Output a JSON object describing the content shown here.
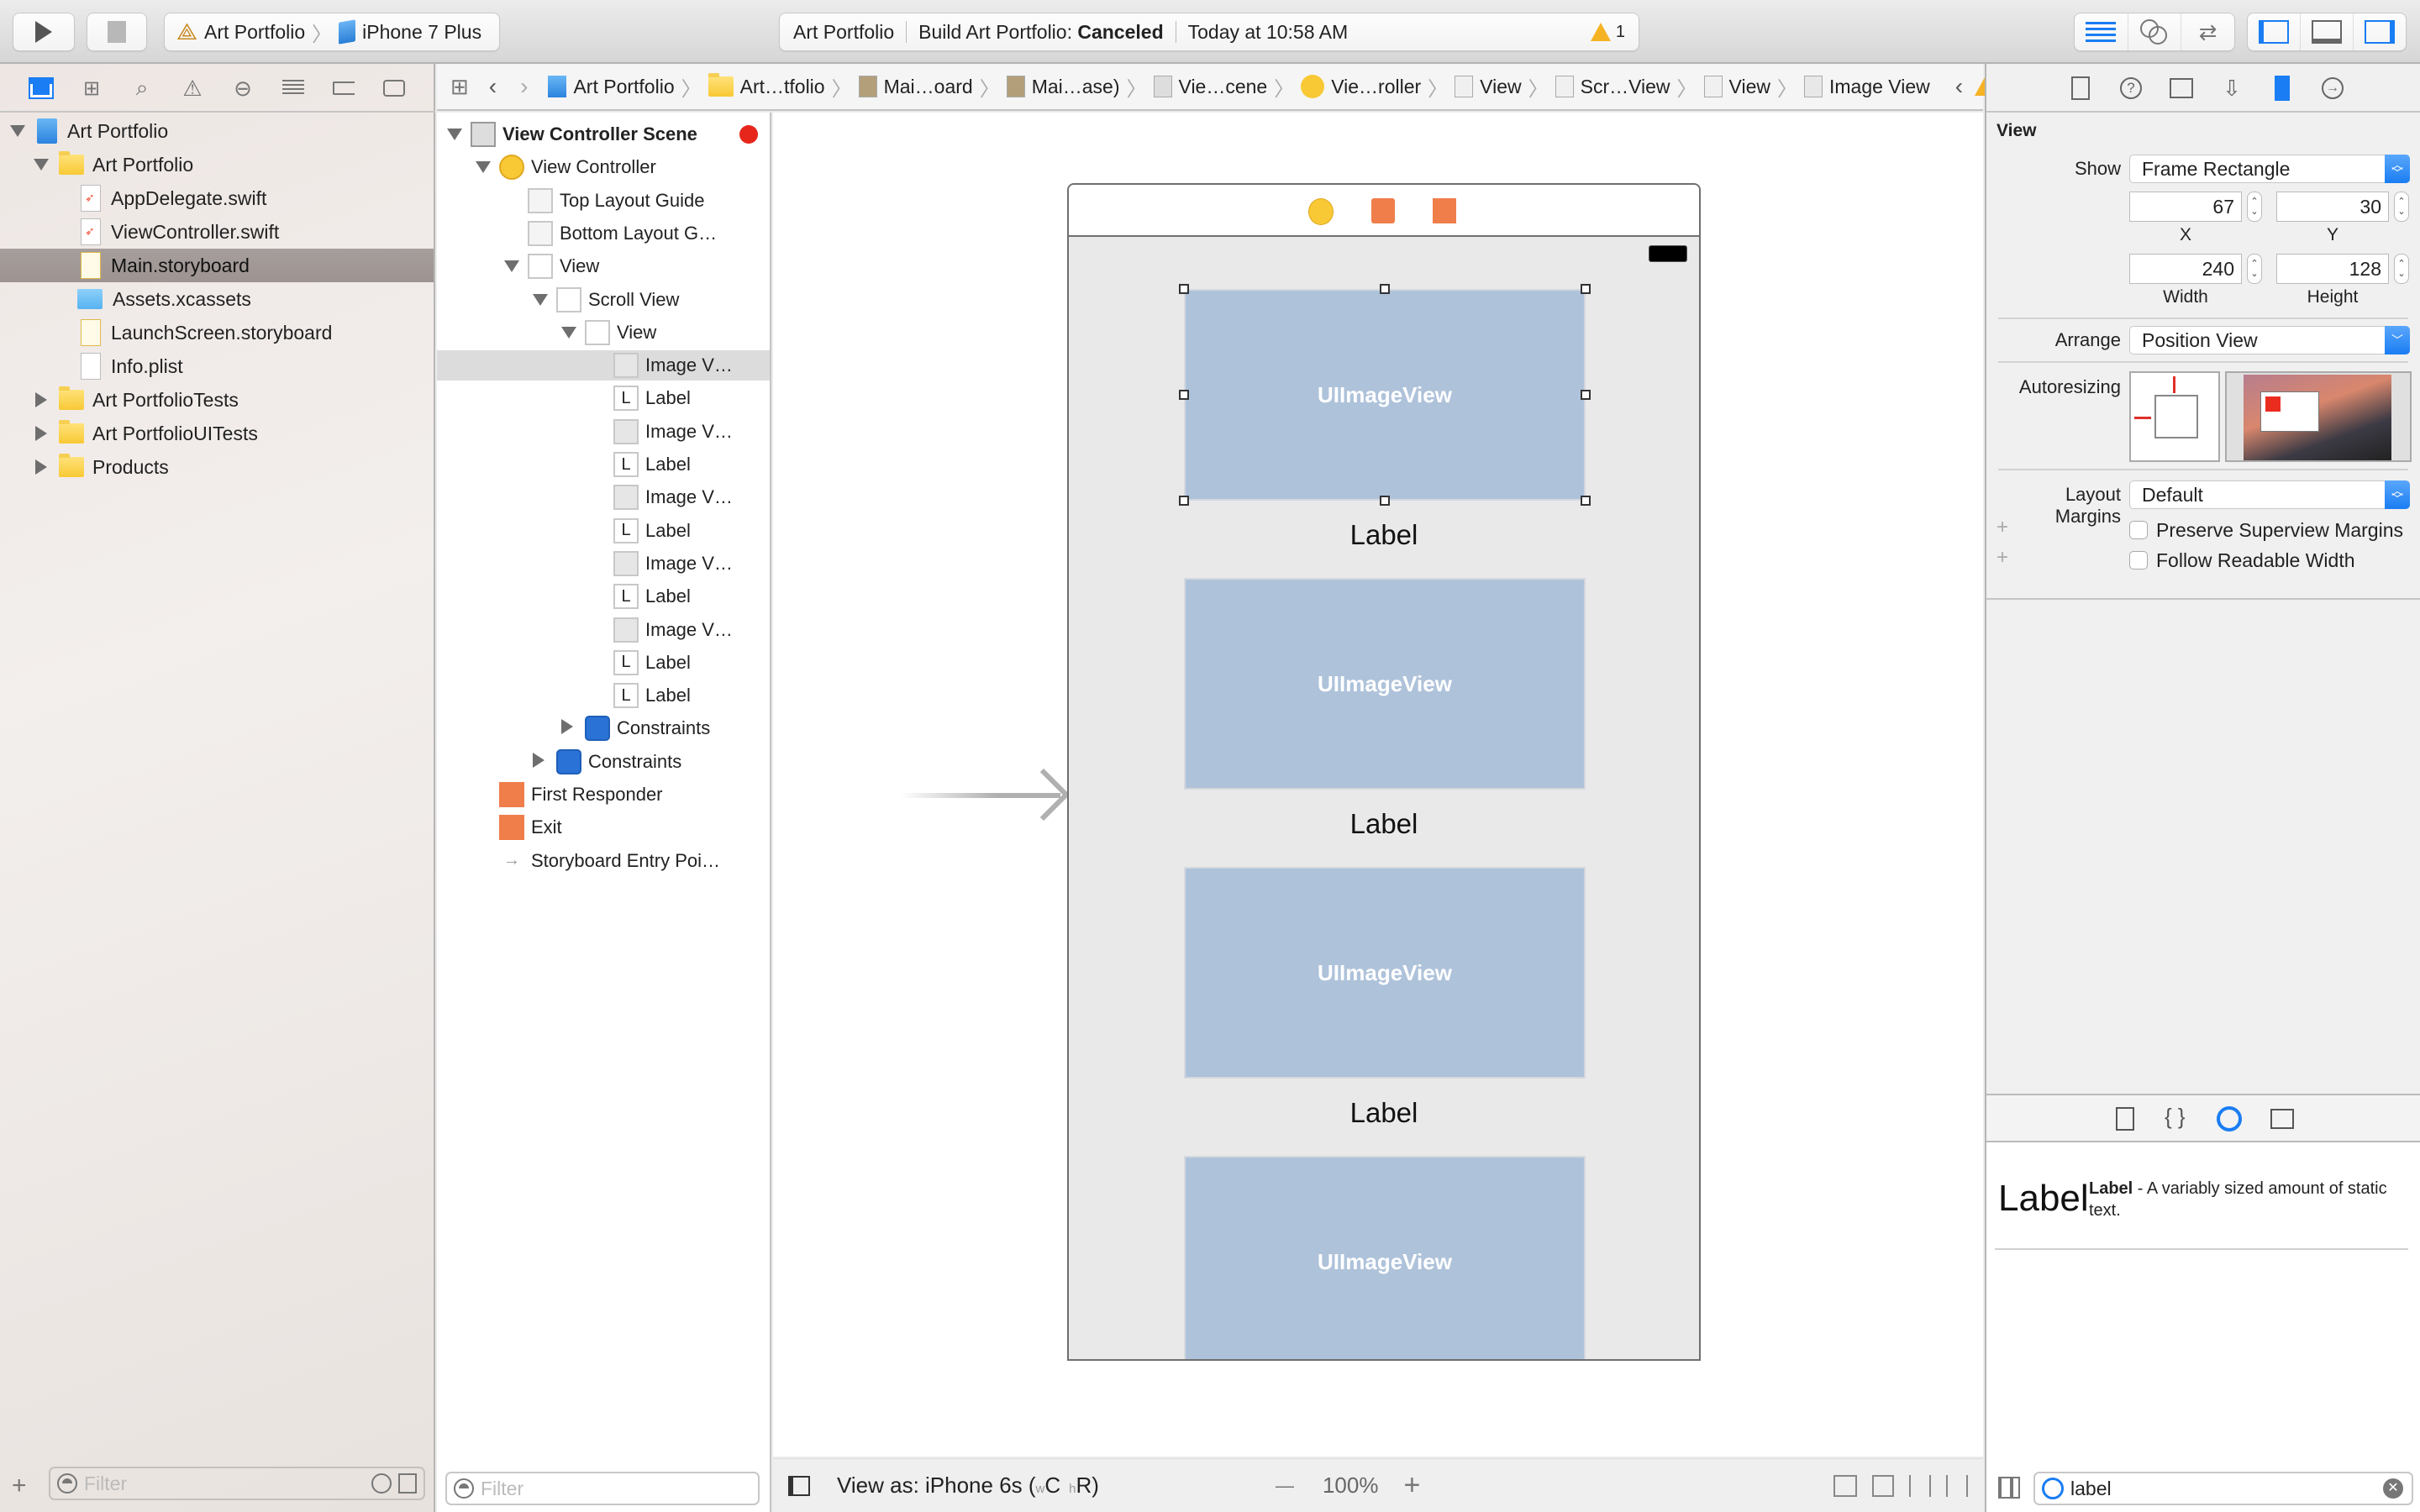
{
  "toolbar": {
    "scheme_project": "Art Portfolio",
    "scheme_device": "iPhone 7 Plus",
    "activity": {
      "project": "Art Portfolio",
      "build_prefix": "Build Art Portfolio: ",
      "build_status": "Canceled",
      "time": "Today at 10:58 AM",
      "warning_count": "1"
    },
    "accent": "#1a7df3"
  },
  "navigator": {
    "tabs": [
      "project-navigator",
      "symbol-navigator",
      "find-navigator",
      "issue-navigator",
      "test-navigator",
      "debug-navigator",
      "breakpoint-navigator",
      "report-navigator"
    ],
    "tree": [
      {
        "label": "Art Portfolio",
        "type": "project",
        "level": 0,
        "expanded": true
      },
      {
        "label": "Art Portfolio",
        "type": "folder",
        "level": 1,
        "expanded": true
      },
      {
        "label": "AppDelegate.swift",
        "type": "swift",
        "level": 2
      },
      {
        "label": "ViewController.swift",
        "type": "swift",
        "level": 2
      },
      {
        "label": "Main.storyboard",
        "type": "storyboard",
        "level": 2,
        "selected": true
      },
      {
        "label": "Assets.xcassets",
        "type": "assets",
        "level": 2
      },
      {
        "label": "LaunchScreen.storyboard",
        "type": "storyboard",
        "level": 2
      },
      {
        "label": "Info.plist",
        "type": "plist",
        "level": 2
      },
      {
        "label": "Art PortfolioTests",
        "type": "folder",
        "level": 1,
        "expanded": false
      },
      {
        "label": "Art PortfolioUITests",
        "type": "folder",
        "level": 1,
        "expanded": false
      },
      {
        "label": "Products",
        "type": "folder",
        "level": 1,
        "expanded": false
      }
    ],
    "filter_placeholder": "Filter"
  },
  "jumpbar": {
    "crumbs": [
      "Art Portfolio",
      "Art…tfolio",
      "Mai…oard",
      "Mai…ase)",
      "Vie…cene",
      "Vie…roller",
      "View",
      "Scr…View",
      "View",
      "Image View"
    ]
  },
  "outline": {
    "rows": [
      {
        "label": "View Controller Scene",
        "icon": "scene",
        "level": 0,
        "disc": "open",
        "bold": true
      },
      {
        "label": "View Controller",
        "icon": "viewcontroller",
        "level": 1,
        "disc": "open"
      },
      {
        "label": "Top Layout Guide",
        "icon": "layoutguide",
        "level": 2
      },
      {
        "label": "Bottom Layout G…",
        "icon": "layoutguide",
        "level": 2
      },
      {
        "label": "View",
        "icon": "view",
        "level": 2,
        "disc": "open"
      },
      {
        "label": "Scroll View",
        "icon": "view",
        "level": 3,
        "disc": "open"
      },
      {
        "label": "View",
        "icon": "view",
        "level": 4,
        "disc": "open"
      },
      {
        "label": "Image V…",
        "icon": "image",
        "level": 5,
        "selected": true
      },
      {
        "label": "Label",
        "icon": "label",
        "level": 5
      },
      {
        "label": "Image V…",
        "icon": "image",
        "level": 5
      },
      {
        "label": "Label",
        "icon": "label",
        "level": 5
      },
      {
        "label": "Image V…",
        "icon": "image",
        "level": 5
      },
      {
        "label": "Label",
        "icon": "label",
        "level": 5
      },
      {
        "label": "Image V…",
        "icon": "image",
        "level": 5
      },
      {
        "label": "Label",
        "icon": "label",
        "level": 5
      },
      {
        "label": "Image V…",
        "icon": "image",
        "level": 5
      },
      {
        "label": "Label",
        "icon": "label",
        "level": 5
      },
      {
        "label": "Label",
        "icon": "label",
        "level": 5
      },
      {
        "label": "Constraints",
        "icon": "constraints",
        "level": 4,
        "disc": "closed"
      },
      {
        "label": "Constraints",
        "icon": "constraints",
        "level": 3,
        "disc": "closed"
      },
      {
        "label": "First Responder",
        "icon": "firstresponder",
        "level": 1
      },
      {
        "label": "Exit",
        "icon": "exit",
        "level": 1
      },
      {
        "label": "Storyboard Entry Poi…",
        "icon": "entry",
        "level": 1
      }
    ],
    "filter_placeholder": "Filter"
  },
  "canvas": {
    "image_view_text": "UIImageView",
    "label_text": "Label",
    "items": [
      {
        "image": "UIImageView",
        "label": "Label"
      },
      {
        "image": "UIImageView",
        "label": "Label"
      },
      {
        "image": "UIImageView",
        "label": "Label"
      },
      {
        "image": "UIImageView"
      }
    ],
    "view_as_prefix": "View as: iPhone 6s (",
    "size_w": "w",
    "size_c": "C",
    "size_h": "h",
    "size_r": "R)",
    "zoom": "100%",
    "zoom_minus": "—",
    "zoom_plus": "+"
  },
  "inspector": {
    "section_title": "View",
    "show_label": "Show",
    "show_value": "Frame Rectangle",
    "x": "67",
    "y": "30",
    "width": "240",
    "height": "128",
    "x_label": "X",
    "y_label": "Y",
    "width_label": "Width",
    "height_label": "Height",
    "arrange_label": "Arrange",
    "arrange_value": "Position View",
    "autoresizing_label": "Autoresizing",
    "layout_margins_label": "Layout Margins",
    "layout_margins_value": "Default",
    "preserve_label": "Preserve Superview Margins",
    "preserve_checked": false,
    "readable_label": "Follow Readable Width",
    "readable_checked": false,
    "plus": "+"
  },
  "library": {
    "item_preview": "Label",
    "item_title": "Label",
    "item_desc": " - A variably sized amount of static text.",
    "search_value": "label"
  }
}
